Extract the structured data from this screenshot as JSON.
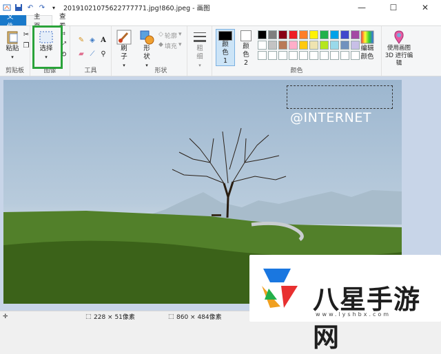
{
  "window": {
    "title": "20191021075622777771.jpg!860.jpeg - 画图"
  },
  "tabs": {
    "file": "文件",
    "home": "主页",
    "view": "查看"
  },
  "ribbon": {
    "clipboard": {
      "paste": "粘贴",
      "group": "剪贴板"
    },
    "image": {
      "select": "选择",
      "group": "图像"
    },
    "tools": {
      "group": "工具"
    },
    "brushes": {
      "label": "刷子"
    },
    "shapes": {
      "label": "形状",
      "outline": "轮廓",
      "fill": "填充",
      "group": "形状"
    },
    "size": {
      "label": "粗细"
    },
    "colors": {
      "color1": "颜色 1",
      "color2": "颜色 2",
      "edit": "编辑颜色",
      "group": "颜色",
      "palette_row1": [
        "#000000",
        "#7f7f7f",
        "#880015",
        "#ed1c24",
        "#ff7f27",
        "#fff200",
        "#22b14c",
        "#00a2e8",
        "#3f48cc",
        "#a349a4"
      ],
      "palette_row2": [
        "#ffffff",
        "#c3c3c3",
        "#b97a57",
        "#ffaec9",
        "#ffc90e",
        "#efe4b0",
        "#b5e61d",
        "#99d9ea",
        "#7092be",
        "#c8bfe7"
      ]
    },
    "paint3d": {
      "label": "使用画图 3D 进行编辑"
    }
  },
  "canvas": {
    "watermark": "@INTERNET"
  },
  "status": {
    "selection": "228 × 51像素",
    "image_size": "860 × 484像素"
  },
  "logo": {
    "text": "八星手游网",
    "url": "www.lyshbx.com"
  }
}
